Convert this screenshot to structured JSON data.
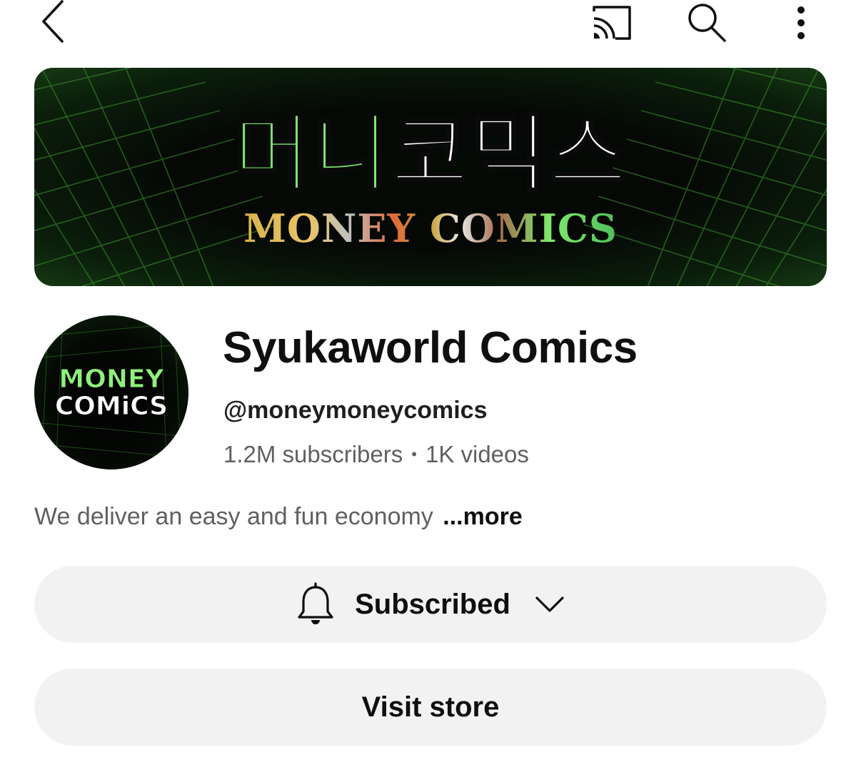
{
  "topbar": {
    "back_icon": "chevron-left-icon",
    "cast_icon": "cast-icon",
    "search_icon": "search-icon",
    "menu_icon": "more-vertical-icon"
  },
  "banner": {
    "korean_title_green": "머니",
    "korean_title_white": "코믹스",
    "subtitle": "MONEY COMICS",
    "accent_color": "#7ee86d"
  },
  "avatar": {
    "line1": "MONEY",
    "line2": "COMiCS"
  },
  "channel": {
    "name": "Syukaworld Comics",
    "handle": "@moneymoneycomics",
    "subscribers": "1.2M subscribers",
    "separator": "•",
    "videos": "1K videos"
  },
  "description": {
    "text": "We deliver an easy and fun economy",
    "more_label": "...more"
  },
  "actions": {
    "subscribed_label": "Subscribed",
    "visit_store_label": "Visit store"
  }
}
